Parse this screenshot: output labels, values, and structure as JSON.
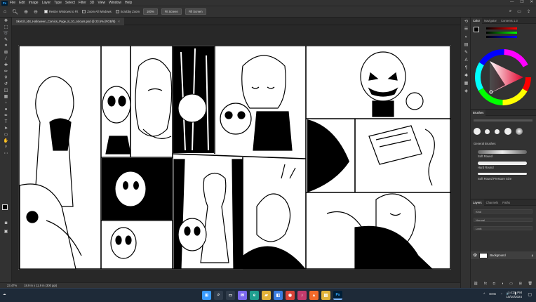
{
  "app": {
    "logo": "Ps"
  },
  "menu": [
    "File",
    "Edit",
    "Image",
    "Layer",
    "Type",
    "Select",
    "Filter",
    "3D",
    "View",
    "Window",
    "Help"
  ],
  "window_controls": [
    "—",
    "❐",
    "✕"
  ],
  "options_bar": {
    "tool_icon": "zoom-icon",
    "checkboxes": [
      "Resize Windows to Fit",
      "Zoom All Windows",
      "Scrubby Zoom"
    ],
    "buttons": [
      "100%",
      "Fit Screen",
      "Fill Screen"
    ]
  },
  "document": {
    "tab_title": "Sketch_l48_Halloween_Comics_Page_8_10_colours.psd @ 23.5% (RGB/8)",
    "close": "×"
  },
  "status": {
    "zoom": "23.47%",
    "doc_size": "18.9 in x 11.9 in (300 ppi)"
  },
  "panels": {
    "color_tabs": [
      "Color",
      "Navigator",
      "Contents 1.3"
    ],
    "brushes_title": "Brushes",
    "brush_group": "General Brushes",
    "brushes": [
      "Soft Round",
      "Hard Round",
      "Soft Round Pressure Size"
    ],
    "layers_tabs": [
      "Layers",
      "Channels",
      "Paths"
    ],
    "layer_controls": [
      "Kind",
      "Normal",
      "Lock"
    ],
    "layer_name": "Background"
  },
  "taskbar": {
    "icons": [
      {
        "name": "windows-start-icon",
        "glyph": "⊞",
        "color": "#3a9bff"
      },
      {
        "name": "search-icon",
        "glyph": "⌕",
        "color": "#2f3b4a"
      },
      {
        "name": "task-view-icon",
        "glyph": "▭",
        "color": "#2f3b4a"
      },
      {
        "name": "chat-icon",
        "glyph": "✉",
        "color": "#7b68ee"
      },
      {
        "name": "edge-icon",
        "glyph": "e",
        "color": "#1f9e8f"
      },
      {
        "name": "file-explorer-icon",
        "glyph": "▰",
        "color": "#e2b23a"
      },
      {
        "name": "store-icon",
        "glyph": "◧",
        "color": "#3b7de0"
      },
      {
        "name": "chrome-icon",
        "glyph": "◉",
        "color": "#d9453a"
      },
      {
        "name": "music-icon",
        "glyph": "♪",
        "color": "#c33b6c"
      },
      {
        "name": "brave-icon",
        "glyph": "▲",
        "color": "#f26a2a"
      },
      {
        "name": "files-icon",
        "glyph": "▤",
        "color": "#e2b23a"
      },
      {
        "name": "photoshop-icon",
        "glyph": "Ps",
        "color": "#001e36"
      }
    ],
    "tray": [
      "^",
      "ENG",
      "◔",
      "🔊",
      "▮"
    ],
    "time": "4:25 PM",
    "date": "10/10/2024"
  }
}
